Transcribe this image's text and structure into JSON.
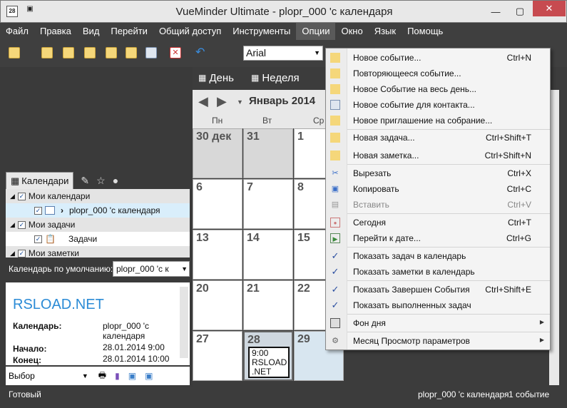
{
  "window": {
    "title": "VueMinder Ultimate - plopr_000 'с календаря",
    "app_icon_text": "28"
  },
  "menu": [
    "Файл",
    "Правка",
    "Вид",
    "Перейти",
    "Общий доступ",
    "Инструменты",
    "Опции",
    "Окно",
    "Язык",
    "Помощь"
  ],
  "menu_active": "Опции",
  "toolbar": {
    "font": "Arial"
  },
  "view_tabs": [
    "День",
    "Неделя"
  ],
  "calendar": {
    "month_label": "Январь 2014",
    "dow": [
      "Пн",
      "Вт",
      "Ср"
    ],
    "weeks": [
      [
        "30 дек",
        "31",
        "1"
      ],
      [
        "6",
        "7",
        "8"
      ],
      [
        "13",
        "14",
        "15"
      ],
      [
        "20",
        "21",
        "22"
      ],
      [
        "27",
        "28",
        "29"
      ]
    ],
    "event": {
      "time": "9:00",
      "title_line1": "RSLOAD",
      "title_line2": ".NET"
    }
  },
  "left_panel": {
    "tab_label": "Календари",
    "tree": [
      {
        "label": "Мои календари",
        "group": true
      },
      {
        "label": "plopr_000 'с календаря",
        "group": false
      },
      {
        "label": "Мои задачи",
        "group": true
      },
      {
        "label": "Задачи",
        "group": false
      },
      {
        "label": "Мои заметки",
        "group": true
      }
    ],
    "default_calendar_label": "Календарь по умолчанию:",
    "default_calendar_value": "plopr_000 'с к",
    "details": {
      "title": "RSLOAD.NET",
      "calendar_label": "Календарь:",
      "calendar_value_1": "plopr_000 'с",
      "calendar_value_2": "календаря",
      "start_label": "Начало:",
      "start_value": "28.01.2014 9:00",
      "end_label": "Конец:",
      "end_value": "28.01.2014 10:00"
    },
    "select_label": "Выбор"
  },
  "dropdown": [
    {
      "label": "Новое событие...",
      "shortcut": "Ctrl+N",
      "icon": "new-event-icon"
    },
    {
      "label": "Повторяющееся событие...",
      "shortcut": "",
      "icon": "recurring-event-icon"
    },
    {
      "label": "Новое Событие на весь день...",
      "shortcut": "",
      "icon": "all-day-event-icon"
    },
    {
      "label": "Новое событие для контакта...",
      "shortcut": "",
      "icon": "contact-event-icon"
    },
    {
      "label": "Новое приглашение на собрание...",
      "shortcut": "",
      "icon": "meeting-invite-icon"
    },
    {
      "label": "Новая задача...",
      "shortcut": "Ctrl+Shift+T",
      "icon": "new-task-icon"
    },
    {
      "label": "Новая заметка...",
      "shortcut": "Ctrl+Shift+N",
      "icon": "new-note-icon"
    },
    {
      "label": "Вырезать",
      "shortcut": "Ctrl+X",
      "icon": "cut-icon"
    },
    {
      "label": "Копировать",
      "shortcut": "Ctrl+C",
      "icon": "copy-icon"
    },
    {
      "label": "Вставить",
      "shortcut": "Ctrl+V",
      "icon": "paste-icon",
      "disabled": true
    },
    {
      "label": "Сегодня",
      "shortcut": "Ctrl+T",
      "icon": "today-icon"
    },
    {
      "label": "Перейти к дате...",
      "shortcut": "Ctrl+G",
      "icon": "go-to-date-icon"
    },
    {
      "label": "Показать задач в календарь",
      "shortcut": "",
      "icon": "check-icon"
    },
    {
      "label": "Показать заметки в календарь",
      "shortcut": "",
      "icon": "check-icon"
    },
    {
      "label": "Показать Завершен События",
      "shortcut": "Ctrl+Shift+E",
      "icon": "check-icon"
    },
    {
      "label": "Показать выполненных задач",
      "shortcut": "",
      "icon": "check-icon"
    },
    {
      "label": "Фон дня",
      "shortcut": "",
      "icon": "background-icon",
      "submenu": true
    },
    {
      "label": "Месяц Просмотр параметров",
      "shortcut": "",
      "icon": "settings-icon",
      "submenu": true
    }
  ],
  "status": {
    "left": "Готовый",
    "calendar": "plopr_000 'с календаря",
    "count": "1 событие"
  },
  "colors": {
    "accent": "#2b8bd6",
    "menubar": "#3f3f3f",
    "close": "#c74b50"
  }
}
